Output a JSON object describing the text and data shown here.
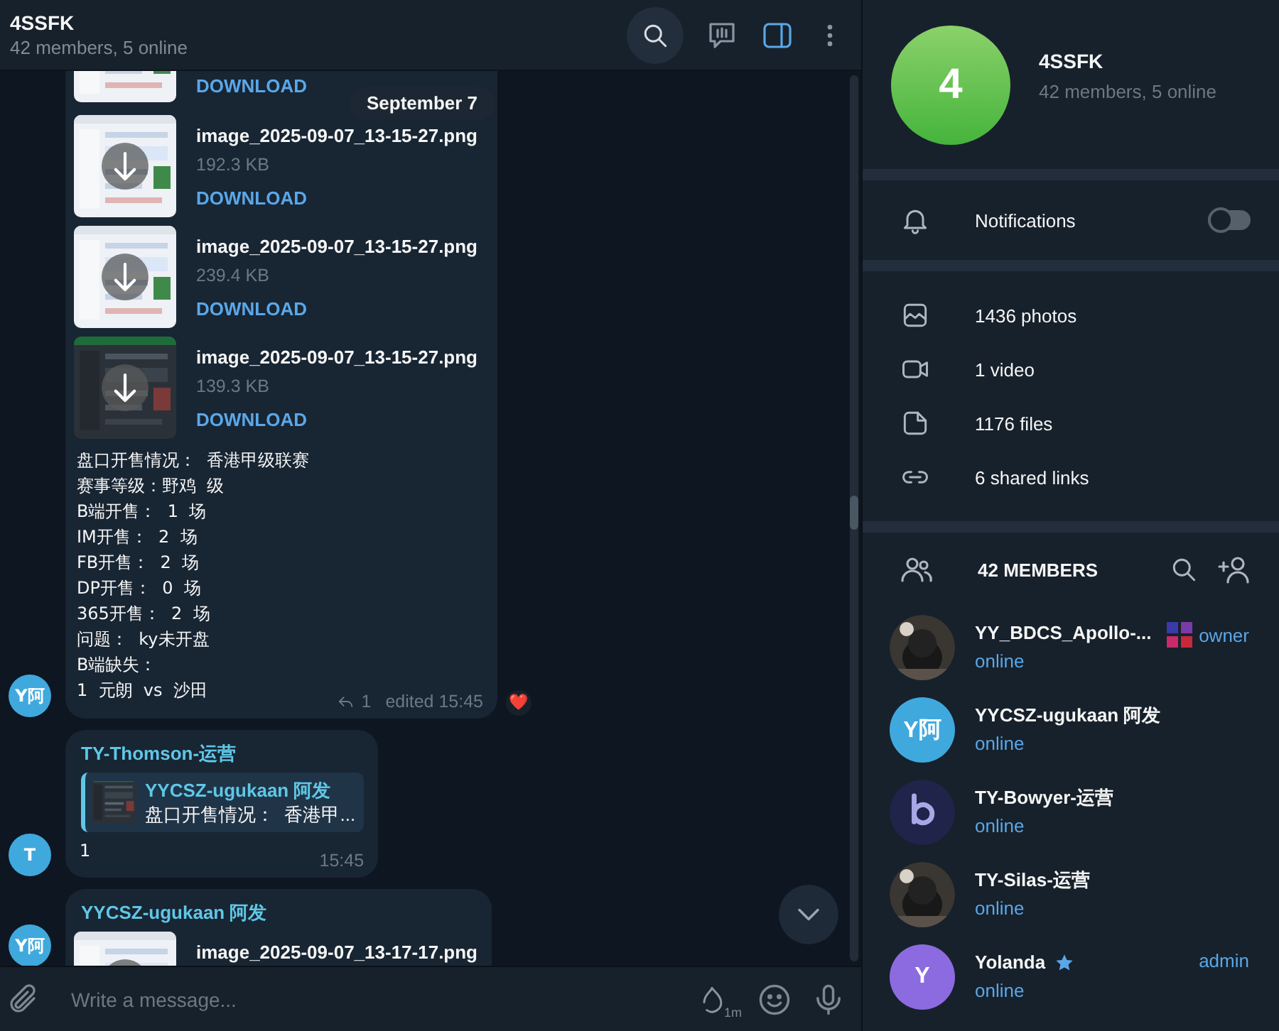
{
  "header": {
    "title": "4SSFK",
    "subtitle": "42 members, 5 online"
  },
  "chat": {
    "date_pill": "September 7",
    "messages": [
      {
        "avatar": {
          "text": "Y阿",
          "color": "#3fa9dd"
        },
        "files": [
          {
            "download": "DOWNLOAD",
            "cut": true
          },
          {
            "name": "image_2025-09-07_13-15-27.png",
            "size": "192.3 KB",
            "download": "DOWNLOAD"
          },
          {
            "name": "image_2025-09-07_13-15-27.png",
            "size": "239.4 KB",
            "download": "DOWNLOAD"
          },
          {
            "name": "image_2025-09-07_13-15-27.png",
            "size": "139.3 KB",
            "download": "DOWNLOAD",
            "dark": true
          }
        ],
        "lines": [
          "盘口开售情况：  香港甲级联赛",
          "赛事等级：野鸡  级",
          "B端开售：  1  场",
          "IM开售：  2  场",
          "FB开售：  2  场",
          "DP开售：  0  场",
          "365开售：  2  场",
          "问题：  ky未开盘",
          "B端缺失：",
          "1  元朗  vs  沙田"
        ],
        "replies": "1",
        "time": "edited 15:45",
        "reaction": "❤️"
      },
      {
        "avatar": {
          "text": "T",
          "color": "#3fa9dd"
        },
        "sender": "TY-Thomson-运营",
        "quote": {
          "sender": "YYCSZ-ugukaan 阿发",
          "text": "盘口开售情况：  香港甲..."
        },
        "lines": [
          "1"
        ],
        "time": "15:45"
      },
      {
        "avatar": {
          "text": "Y阿",
          "color": "#3fa9dd"
        },
        "sender": "YYCSZ-ugukaan 阿发",
        "files": [
          {
            "name": "image_2025-09-07_13-17-17.png"
          }
        ]
      }
    ]
  },
  "composer": {
    "placeholder": "Write a message...",
    "timer": "1m"
  },
  "profile": {
    "avatar": "4",
    "title": "4SSFK",
    "subtitle": "42 members, 5 online"
  },
  "notifications": {
    "label": "Notifications",
    "on": false
  },
  "media": [
    {
      "kind": "photos",
      "label": "1436 photos"
    },
    {
      "kind": "video",
      "label": "1 video"
    },
    {
      "kind": "files",
      "label": "1176 files"
    },
    {
      "kind": "links",
      "label": "6 shared links"
    }
  ],
  "members_header": "42 MEMBERS",
  "members": [
    {
      "name": "YY_BDCS_Apollo-...",
      "status": "online",
      "role": "owner",
      "badge": true
    },
    {
      "name": "YYCSZ-ugukaan 阿发",
      "status": "online",
      "avatar": {
        "kind": "letter",
        "text": "Y阿",
        "color": "#3fa9dd"
      }
    },
    {
      "name": "TY-Bowyer-运营",
      "status": "online",
      "avatar": {
        "kind": "logo"
      }
    },
    {
      "name": "TY-Silas-运营",
      "status": "online"
    },
    {
      "name": "Yolanda",
      "status": "online",
      "role": "admin",
      "star": true,
      "avatar": {
        "kind": "letter",
        "text": "Y",
        "color": "#8c6be0"
      }
    }
  ]
}
